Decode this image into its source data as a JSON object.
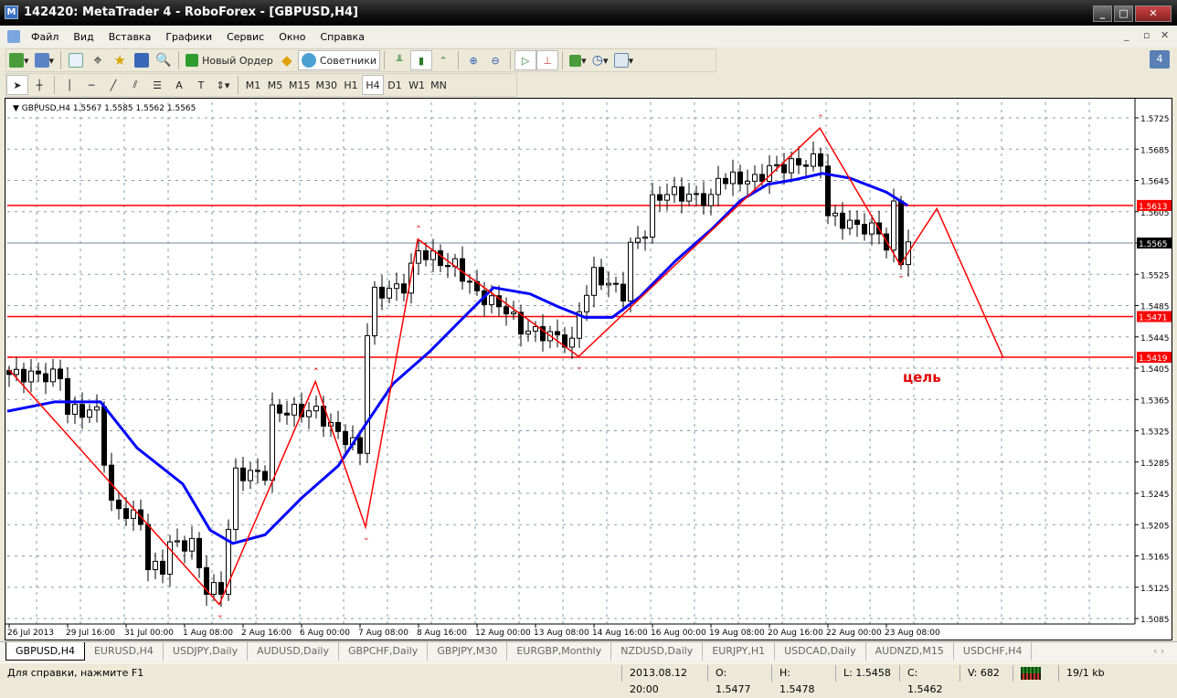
{
  "window": {
    "title": "142420: MetaTrader 4 - RoboForex - [GBPUSD,H4]"
  },
  "menu": [
    "Файл",
    "Вид",
    "Вставка",
    "Графики",
    "Сервис",
    "Окно",
    "Справка"
  ],
  "toolbar": {
    "new_order": "Новый Ордер",
    "experts": "Советники"
  },
  "timeframes": [
    "M1",
    "M5",
    "M15",
    "M30",
    "H1",
    "H4",
    "D1",
    "W1",
    "MN"
  ],
  "active_timeframe": "H4",
  "chart_header": "GBPUSD,H4  1.5567 1.5585 1.5562 1.5565",
  "chart_data": {
    "type": "candlestick",
    "symbol": "GBPUSD",
    "timeframe": "H4",
    "ylim": [
      1.506,
      1.576
    ],
    "y_ticks": [
      1.5725,
      1.5685,
      1.5645,
      1.5605,
      1.5565,
      1.5525,
      1.5485,
      1.5445,
      1.5405,
      1.5365,
      1.5325,
      1.5285,
      1.5245,
      1.5205,
      1.5165,
      1.5125,
      1.5085
    ],
    "x_ticks": [
      {
        "i": 0,
        "label": "26 Jul 2013"
      },
      {
        "i": 8,
        "label": "29 Jul 16:00"
      },
      {
        "i": 16,
        "label": "31 Jul 00:00"
      },
      {
        "i": 24,
        "label": "1 Aug 08:00"
      },
      {
        "i": 32,
        "label": "2 Aug 16:00"
      },
      {
        "i": 40,
        "label": "6 Aug 00:00"
      },
      {
        "i": 48,
        "label": "7 Aug 08:00"
      },
      {
        "i": 56,
        "label": "8 Aug 16:00"
      },
      {
        "i": 64,
        "label": "12 Aug 00:00"
      },
      {
        "i": 72,
        "label": "13 Aug 08:00"
      },
      {
        "i": 80,
        "label": "14 Aug 16:00"
      },
      {
        "i": 88,
        "label": "16 Aug 00:00"
      },
      {
        "i": 96,
        "label": "19 Aug 08:00"
      },
      {
        "i": 104,
        "label": "20 Aug 16:00"
      },
      {
        "i": 112,
        "label": "22 Aug 00:00"
      },
      {
        "i": 120,
        "label": "23 Aug 08:00"
      }
    ],
    "close_keypoints": [
      [
        0,
        1.5397
      ],
      [
        7,
        1.5395
      ],
      [
        8,
        1.535
      ],
      [
        12,
        1.535
      ],
      [
        14,
        1.523
      ],
      [
        18,
        1.521
      ],
      [
        19,
        1.515
      ],
      [
        21,
        1.515
      ],
      [
        22,
        1.518
      ],
      [
        25,
        1.518
      ],
      [
        27,
        1.5122
      ],
      [
        29,
        1.5122
      ],
      [
        30,
        1.52
      ],
      [
        31,
        1.527
      ],
      [
        35,
        1.527
      ],
      [
        36,
        1.535
      ],
      [
        42,
        1.535
      ],
      [
        44,
        1.533
      ],
      [
        48,
        1.53
      ],
      [
        49,
        1.545
      ],
      [
        50,
        1.55
      ],
      [
        54,
        1.551
      ],
      [
        56,
        1.5555
      ],
      [
        60,
        1.5537
      ],
      [
        61,
        1.5537
      ],
      [
        64,
        1.55
      ],
      [
        68,
        1.548
      ],
      [
        70,
        1.5455
      ],
      [
        75,
        1.5445
      ],
      [
        77,
        1.5435
      ],
      [
        78,
        1.548
      ],
      [
        80,
        1.5525
      ],
      [
        84,
        1.55
      ],
      [
        85,
        1.556
      ],
      [
        87,
        1.558
      ],
      [
        88,
        1.5618
      ],
      [
        90,
        1.563
      ],
      [
        96,
        1.562
      ],
      [
        97,
        1.5648
      ],
      [
        102,
        1.5645
      ],
      [
        104,
        1.566
      ],
      [
        110,
        1.567
      ],
      [
        111,
        1.567
      ],
      [
        112,
        1.56
      ],
      [
        115,
        1.5589
      ],
      [
        119,
        1.558
      ],
      [
        120,
        1.556
      ],
      [
        121,
        1.561
      ],
      [
        122,
        1.5545
      ],
      [
        123,
        1.5565
      ]
    ],
    "moving_average": [
      [
        -0.25,
        1.535
      ],
      [
        6.25,
        1.5362
      ],
      [
        12.5,
        1.5362
      ],
      [
        17.5,
        1.5303
      ],
      [
        23.75,
        1.5257
      ],
      [
        27.5,
        1.5198
      ],
      [
        30.6,
        1.5181
      ],
      [
        35,
        1.5192
      ],
      [
        40,
        1.5239
      ],
      [
        45,
        1.528
      ],
      [
        48.75,
        1.5333
      ],
      [
        52.5,
        1.5385
      ],
      [
        57.5,
        1.5426
      ],
      [
        62.5,
        1.5473
      ],
      [
        66.25,
        1.5508
      ],
      [
        71.25,
        1.55
      ],
      [
        75,
        1.5484
      ],
      [
        78.75,
        1.547
      ],
      [
        82.5,
        1.547
      ],
      [
        86.25,
        1.5496
      ],
      [
        91.25,
        1.5543
      ],
      [
        96.25,
        1.5584
      ],
      [
        100,
        1.5619
      ],
      [
        103.75,
        1.564
      ],
      [
        107.5,
        1.5646
      ],
      [
        111.25,
        1.5654
      ],
      [
        115,
        1.5648
      ],
      [
        120,
        1.563
      ],
      [
        122.9,
        1.5613
      ]
    ],
    "zigzag": [
      [
        0,
        1.5403
      ],
      [
        28.75,
        1.5103
      ],
      [
        41.9,
        1.5388
      ],
      [
        48.75,
        1.5202
      ],
      [
        55.9,
        1.557
      ],
      [
        77.9,
        1.542
      ],
      [
        110.9,
        1.5712
      ],
      [
        121.9,
        1.5537
      ],
      [
        126.9,
        1.5609
      ],
      [
        136,
        1.5418
      ]
    ],
    "levels": [
      {
        "price": "1.5613"
      },
      {
        "price": "1.5471"
      },
      {
        "price": "1.5419"
      }
    ],
    "bid": "1.5565",
    "annotation": "цель",
    "colors": {
      "level": "#ff0000",
      "ma": "#0000ff",
      "zigzag": "#ff0000",
      "grid": "#8a98a8"
    }
  },
  "tabs": [
    "GBPUSD,H4",
    "EURUSD,H4",
    "USDJPY,Daily",
    "AUDUSD,Daily",
    "GBPCHF,Daily",
    "GBPJPY,M30",
    "EURGBP,Monthly",
    "NZDUSD,Daily",
    "EURJPY,H1",
    "USDCAD,Daily",
    "AUDNZD,M15",
    "USDCHF,H4"
  ],
  "status": {
    "help": "Для справки, нажмите F1",
    "time": "2013.08.12 20:00",
    "open": "O: 1.5477",
    "high": "H: 1.5478",
    "low": "L: 1.5458",
    "close": "C: 1.5462",
    "volume": "V: 682",
    "traffic": "19/1 kb"
  }
}
